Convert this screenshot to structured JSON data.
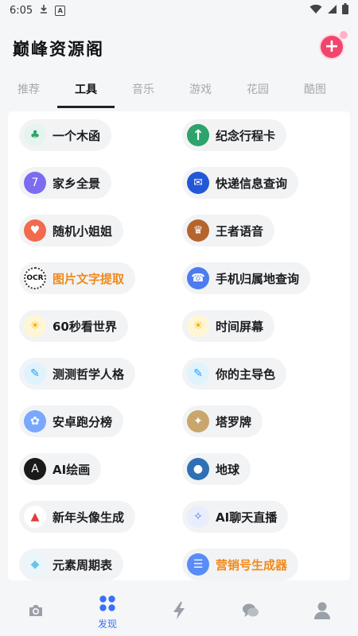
{
  "status": {
    "time": "6:05"
  },
  "app": {
    "title": "巅峰资源阁",
    "add_icon": "plus-icon"
  },
  "tabs": [
    {
      "label": "推荐",
      "active": false
    },
    {
      "label": "工具",
      "active": true
    },
    {
      "label": "音乐",
      "active": false
    },
    {
      "label": "游戏",
      "active": false
    },
    {
      "label": "花园",
      "active": false
    },
    {
      "label": "酷图",
      "active": false
    }
  ],
  "tools": [
    {
      "label": "一个木函",
      "icon": "tree-icon",
      "color": "#e6f4ee"
    },
    {
      "label": "纪念行程卡",
      "icon": "arrow-up-icon",
      "color": "#2ea36b"
    },
    {
      "label": "家乡全景",
      "icon": "panorama-720-icon",
      "color": "#7b6cf0"
    },
    {
      "label": "快递信息查询",
      "icon": "express-icon",
      "color": "#2456d8"
    },
    {
      "label": "随机小姐姐",
      "icon": "heart-icon",
      "color": "#f26b4e"
    },
    {
      "label": "王者语音",
      "icon": "game-avatar-icon",
      "color": "#b5652c"
    },
    {
      "label": "图片文字提取",
      "icon": "ocr-icon",
      "color": "#ffffff",
      "highlight": true
    },
    {
      "label": "手机归属地查询",
      "icon": "phone-location-icon",
      "color": "#4c7cf0"
    },
    {
      "label": "60秒看世界",
      "icon": "sun-icon",
      "color": "#fff6d6"
    },
    {
      "label": "时间屏幕",
      "icon": "sun-icon",
      "color": "#fff6d6"
    },
    {
      "label": "测测哲学人格",
      "icon": "note-icon",
      "color": "#dff3ff"
    },
    {
      "label": "你的主导色",
      "icon": "note-icon",
      "color": "#dff3ff"
    },
    {
      "label": "安卓跑分榜",
      "icon": "rabbit-icon",
      "color": "#7aa8ff"
    },
    {
      "label": "塔罗牌",
      "icon": "tarot-icon",
      "color": "#c9a66b"
    },
    {
      "label": "AI绘画",
      "icon": "ai-art-icon",
      "color": "#1a1a1a"
    },
    {
      "label": "地球",
      "icon": "globe-icon",
      "color": "#2f6fb5"
    },
    {
      "label": "新年头像生成",
      "icon": "santa-hat-icon",
      "color": "#ffffff"
    },
    {
      "label": "AI聊天直播",
      "icon": "chat-live-icon",
      "color": "#e8eefb"
    },
    {
      "label": "元素周期表",
      "icon": "element-icon",
      "color": "#eaf6fb"
    },
    {
      "label": "营销号生成器",
      "icon": "list-icon",
      "color": "#5a8cf7",
      "highlight": true
    }
  ],
  "bottom_nav": [
    {
      "icon": "camera-icon",
      "label": ""
    },
    {
      "icon": "grid-icon",
      "label": "发现",
      "active": true
    },
    {
      "icon": "lightning-icon",
      "label": ""
    },
    {
      "icon": "chat-icon",
      "label": ""
    },
    {
      "icon": "user-icon",
      "label": ""
    }
  ]
}
